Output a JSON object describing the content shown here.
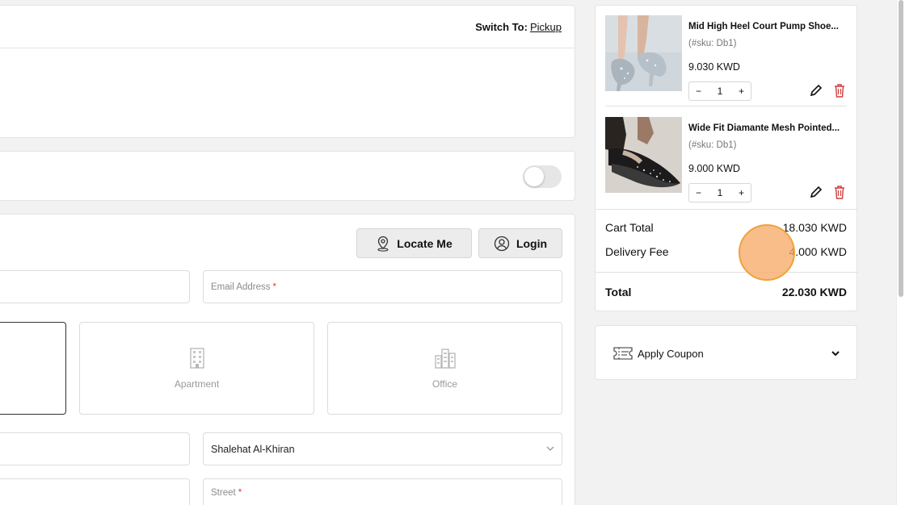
{
  "delivery": {
    "switch_label": "Switch To:",
    "switch_link": "Pickup"
  },
  "form": {
    "locate_label": "Locate Me",
    "login_label": "Login",
    "email_placeholder": "Email Address",
    "required_mark": "*",
    "address_types": [
      {
        "label": "",
        "icon": "house-icon",
        "selected": true
      },
      {
        "label": "Apartment",
        "icon": "apartment-building-icon",
        "selected": false
      },
      {
        "label": "Office",
        "icon": "office-buildings-icon",
        "selected": false
      }
    ],
    "area_value": "Shalehat Al-Khiran",
    "street_placeholder": "Street"
  },
  "cart": {
    "items": [
      {
        "name": "Mid High Heel Court Pump Shoe...",
        "sku": "(#sku: Db1)",
        "price": "9.030 KWD",
        "qty": "1",
        "image": "silver-glitter-heel-photo"
      },
      {
        "name": "Wide Fit Diamante Mesh Pointed...",
        "sku": "(#sku: Db1)",
        "price": "9.000 KWD",
        "qty": "1",
        "image": "black-diamante-mesh-heel-photo"
      }
    ],
    "stepper_minus": "−",
    "stepper_plus": "+",
    "cart_total_label": "Cart Total",
    "cart_total_value": "18.030 KWD",
    "delivery_fee_label": "Delivery Fee",
    "delivery_fee_value": "4.000 KWD",
    "total_label": "Total",
    "total_value": "22.030 KWD"
  },
  "coupon": {
    "label": "Apply Coupon"
  },
  "colors": {
    "delete": "#d23c3c",
    "click_highlight": "#f6aa66",
    "selected_border": "#333333"
  }
}
